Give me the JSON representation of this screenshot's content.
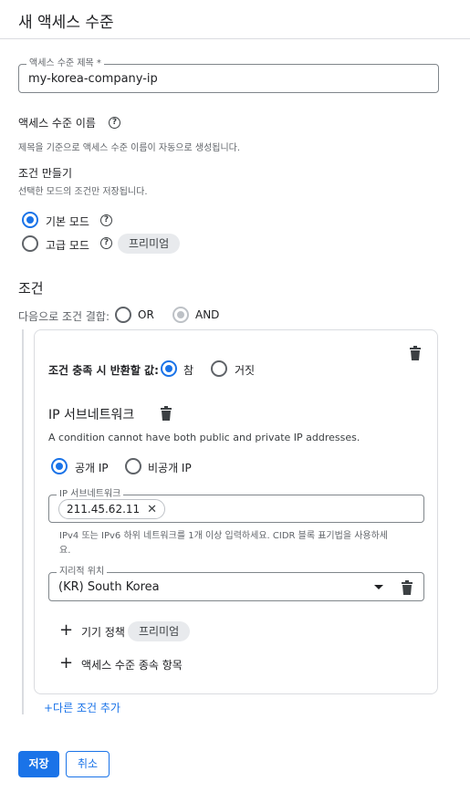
{
  "header": {
    "title": "새 액세스 수준"
  },
  "title_field": {
    "label": "액세스 수준 제목 *",
    "value": "my-korea-company-ip"
  },
  "level_name": {
    "label": "액세스 수준 이름",
    "hint": "제목을 기준으로 액세스 수준 이름이 자동으로 생성됩니다."
  },
  "create_condition": {
    "heading": "조건 만들기",
    "hint": "선택한 모드의 조건만 저장됩니다."
  },
  "modes": {
    "basic": {
      "label": "기본 모드",
      "selected": true
    },
    "advanced": {
      "label": "고급 모드",
      "selected": false,
      "badge": "프리미엄"
    }
  },
  "conditions": {
    "heading": "조건",
    "combine_label": "다음으로 조건 결합:",
    "or_label": "OR",
    "and_label": "AND",
    "and_selected": true
  },
  "condition_card": {
    "return_label": "조건 충족 시 반환할 값:",
    "true_label": "참",
    "false_label": "거짓",
    "return_true_selected": true,
    "subnet_heading": "IP 서브네트워크",
    "subnet_error": "A condition cannot have both public and private IP addresses.",
    "public_ip_label": "공개 IP",
    "private_ip_label": "비공개 IP",
    "public_ip_selected": true,
    "subnet_field": {
      "label": "IP 서브네트워크",
      "chip": "211.45.62.11",
      "hint_line1": "IPv4 또는 IPv6 하위 네트워크를 1개 이상 입력하세요. CIDR 블록 표기법을 사용하세",
      "hint_line2": "요."
    },
    "location_field": {
      "label": "지리적 위치",
      "value": "(KR) South Korea"
    },
    "device_policy": {
      "label": "기기 정책",
      "badge": "프리미엄"
    },
    "dependency": {
      "label": "액세스 수준 종속 항목"
    },
    "icons": {
      "delete": "trash-icon",
      "add": "plus-icon",
      "close": "close-icon",
      "dropdown": "caret-down-icon"
    }
  },
  "add_condition": "+다른 조건 추가",
  "actions": {
    "save": "저장",
    "cancel": "취소"
  },
  "colors": {
    "accent": "#1a73e8",
    "text": "#202124",
    "muted": "#5f6368",
    "border": "#dadce0",
    "chip_bg": "#e8eaed"
  }
}
